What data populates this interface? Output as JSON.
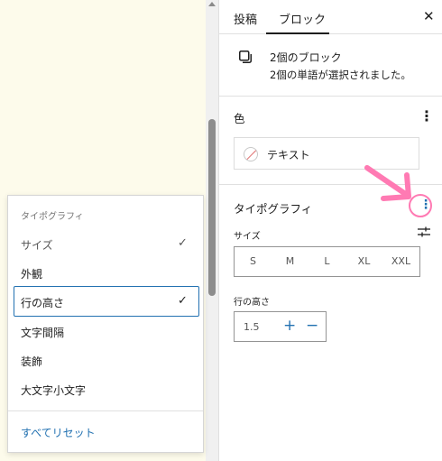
{
  "tabs": {
    "post": "投稿",
    "block": "ブロック"
  },
  "block_card": {
    "title": "2個のブロック",
    "description": "2個の単語が選択されました。"
  },
  "color_panel": {
    "title": "色",
    "items": [
      {
        "label": "テキスト"
      }
    ]
  },
  "typography_panel": {
    "title": "タイポグラフィ",
    "size_label": "サイズ",
    "size_options": [
      "S",
      "M",
      "L",
      "XL",
      "XXL"
    ],
    "line_height_label": "行の高さ",
    "line_height_value": "1.5"
  },
  "typography_menu": {
    "header": "タイポグラフィ",
    "items": [
      {
        "label": "サイズ",
        "checked": true
      },
      {
        "label": "外観",
        "checked": false
      },
      {
        "label": "行の高さ",
        "checked": true
      },
      {
        "label": "文字間隔",
        "checked": false
      },
      {
        "label": "装飾",
        "checked": false
      },
      {
        "label": "大文字小文字",
        "checked": false
      }
    ],
    "reset_label": "すべてリセット"
  },
  "colors": {
    "accent": "#2271b1",
    "annotation_arrow": "#ff7ab3",
    "canvas_background": "#fdfbeb"
  }
}
